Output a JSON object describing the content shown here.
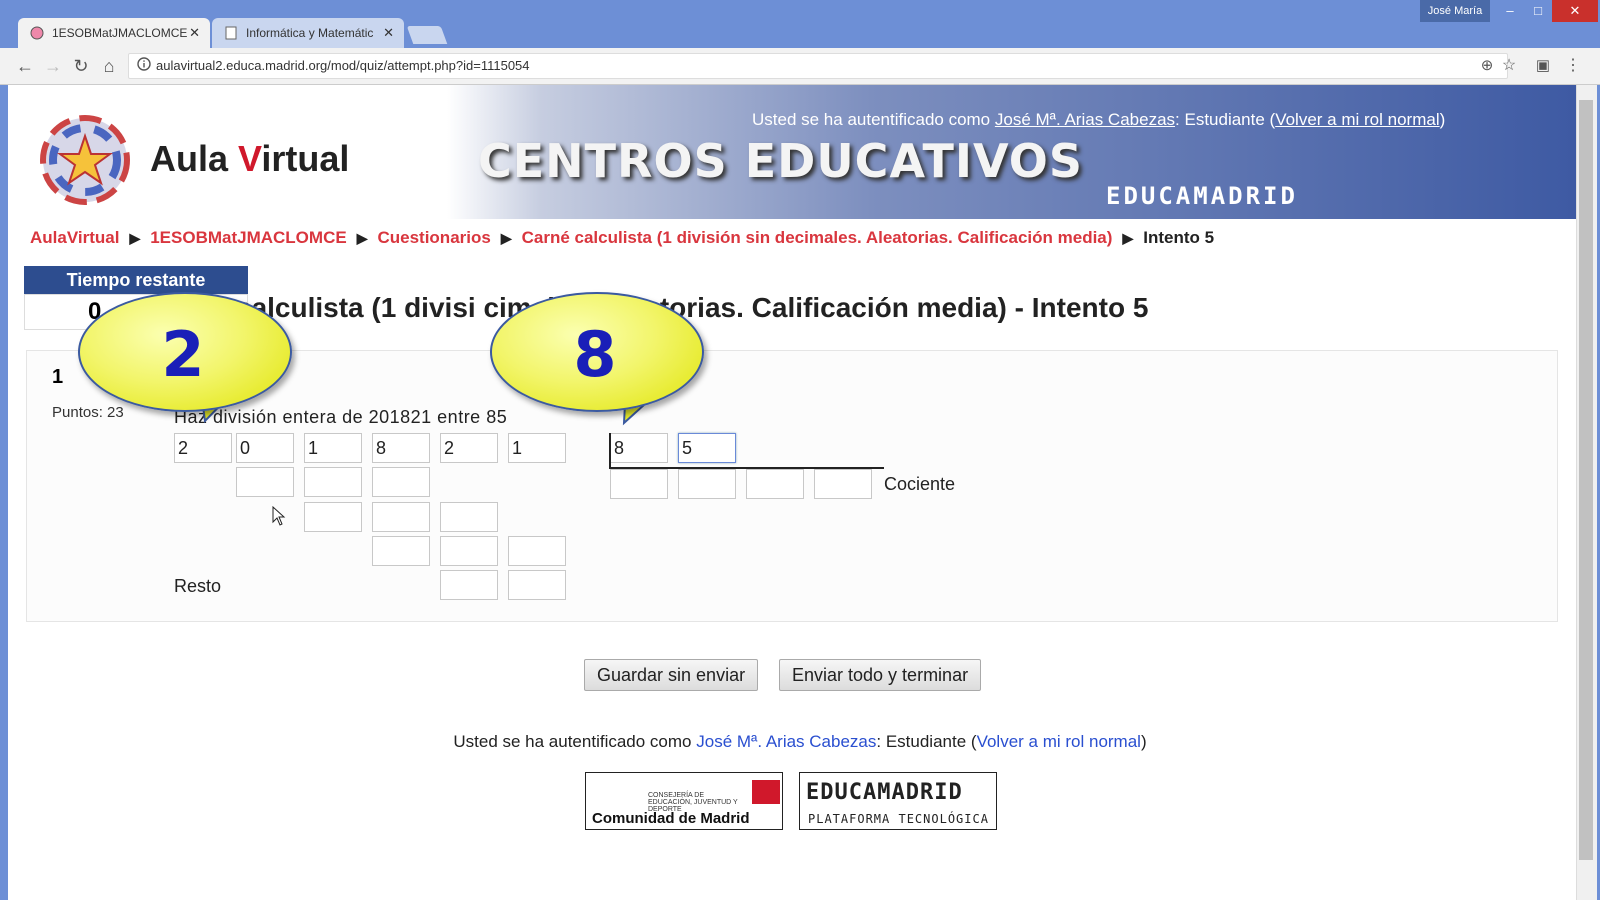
{
  "browser": {
    "tabs": [
      {
        "label": "1ESOBMatJMACLOMCE",
        "active": true
      },
      {
        "label": "Informática y Matemátic",
        "active": false
      }
    ],
    "user_badge": "José María",
    "url": "aulavirtual2.educa.madrid.org/mod/quiz/attempt.php?id=1115054"
  },
  "banner": {
    "title_prefix": "Aula ",
    "title_v": "V",
    "title_suffix": "irtual",
    "big_text": "CENTROS EDUCATIVOS",
    "edu_text": "EDUCAMADRID",
    "login_prefix": "Usted se ha autentificado como ",
    "login_user": "José Mª. Arias Cabezas",
    "login_role": ": Estudiante (",
    "login_link": "Volver a mi rol normal",
    "login_close": ")"
  },
  "breadcrumb": {
    "items": [
      "AulaVirtual",
      "1ESOBMatJMACLOMCE",
      "Cuestionarios",
      "Carné calculista (1 división sin decimales. Aleatorias. Calificación media)"
    ],
    "current": "Intento 5",
    "separator": "▶"
  },
  "timer": {
    "label": "Tiempo restante",
    "value": "0"
  },
  "quiz_title": "calculista (1 divisi          cimales. Aleatorias. Calificación media) - Intento 5",
  "question": {
    "number": "1",
    "points": "Puntos: 23",
    "text": "Haz    división entera de 201821 entre 85",
    "dividend_cells": [
      "2",
      "0",
      "1",
      "8",
      "2",
      "1"
    ],
    "divisor_cells": [
      "8",
      "5"
    ],
    "quotient_label": "Cociente",
    "remainder_label": "Resto"
  },
  "buttons": {
    "save": "Guardar sin enviar",
    "submit": "Enviar todo y terminar"
  },
  "footer": {
    "login_prefix": "Usted se ha autentificado como ",
    "login_user": "José Mª. Arias Cabezas",
    "login_role": ": Estudiante (",
    "login_link": "Volver a mi rol normal",
    "login_close": ")",
    "logo_madrid_small": "CONSEJERÍA DE EDUCACIÓN, JUVENTUD Y DEPORTE",
    "logo_madrid": "Comunidad de Madrid",
    "logo_edu": "EDUCAMADRID",
    "logo_edu_sub": "PLATAFORMA TECNOLÓGICA"
  },
  "overlays": {
    "bubble_left": "2",
    "bubble_right": "8"
  },
  "colors": {
    "link_red": "#d9363e",
    "timer_blue": "#2d4d8f",
    "link_blue": "#2a4fd0",
    "bubble_yellow": "#f2f56a"
  }
}
